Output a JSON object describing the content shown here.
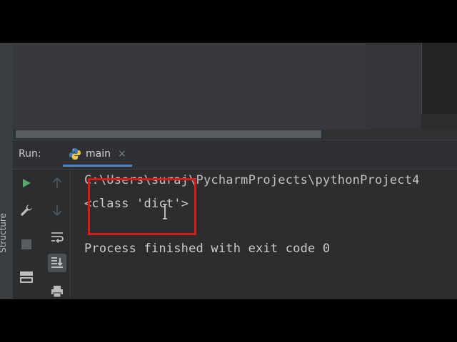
{
  "run_panel": {
    "label": "Run:",
    "tab_label": "main",
    "tab_close": "×"
  },
  "side_bar": {
    "structure_label": "Structure"
  },
  "console": {
    "path_line": "C:\\Users\\suraj\\PycharmProjects\\pythonProject4",
    "output_line": "<class 'dict'>",
    "exit_line": "Process finished with exit code 0"
  },
  "icons": [
    "python-icon",
    "run-icon",
    "up-arrow-icon",
    "down-arrow-icon",
    "wrench-icon",
    "soft-wrap-icon",
    "stop-icon",
    "scroll-to-end-icon",
    "layout-icon",
    "print-icon"
  ],
  "colors": {
    "run_green": "#59a869",
    "highlight_red": "#d91a1a",
    "tab_underline": "#4a88c7"
  }
}
